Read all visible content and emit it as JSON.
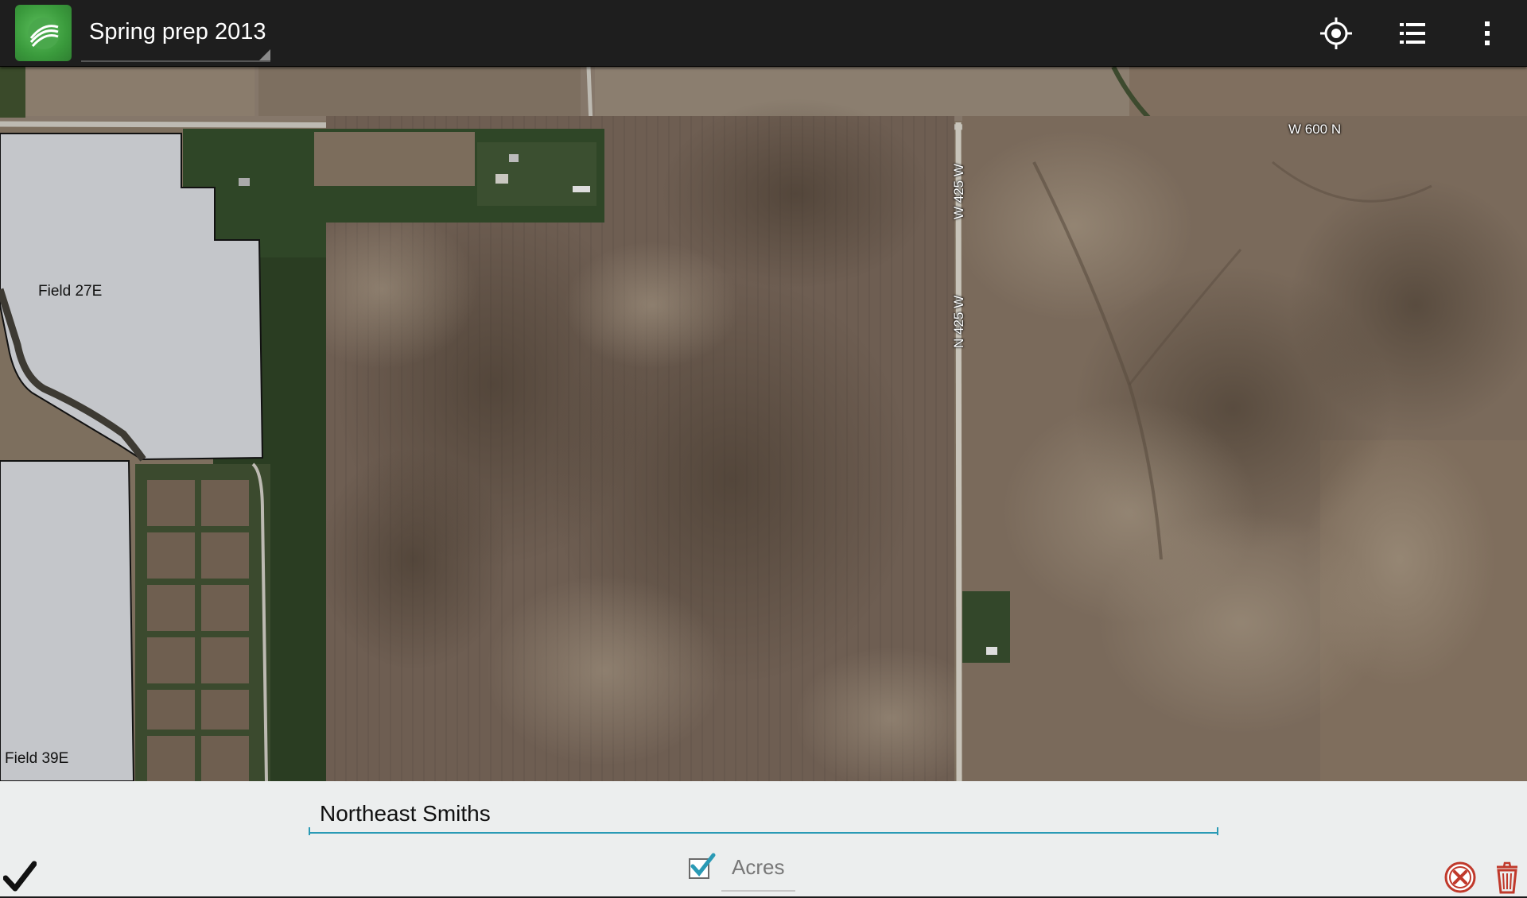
{
  "actionbar": {
    "title": "Spring prep 2013",
    "icons": [
      "app-logo-icon",
      "my-location-icon",
      "list-icon",
      "overflow-menu-icon"
    ]
  },
  "map": {
    "field_labels": [
      "Field 27E",
      "Field 39E"
    ],
    "road_labels": [
      "W 600 N",
      "W 425 W",
      "N 425 W"
    ]
  },
  "editor": {
    "field_name_value": "Northeast Smiths",
    "acres_checked": true,
    "acres_label": "Acres",
    "icons": [
      "checkmark-icon",
      "cancel-icon",
      "trash-icon"
    ]
  },
  "colors": {
    "accent": "#2a9ab5",
    "actionbar": "#1e1e1e",
    "editor_bg": "#eceeee",
    "field_overlay": "#c4c6ca",
    "cancel_red": "#c0392b"
  }
}
